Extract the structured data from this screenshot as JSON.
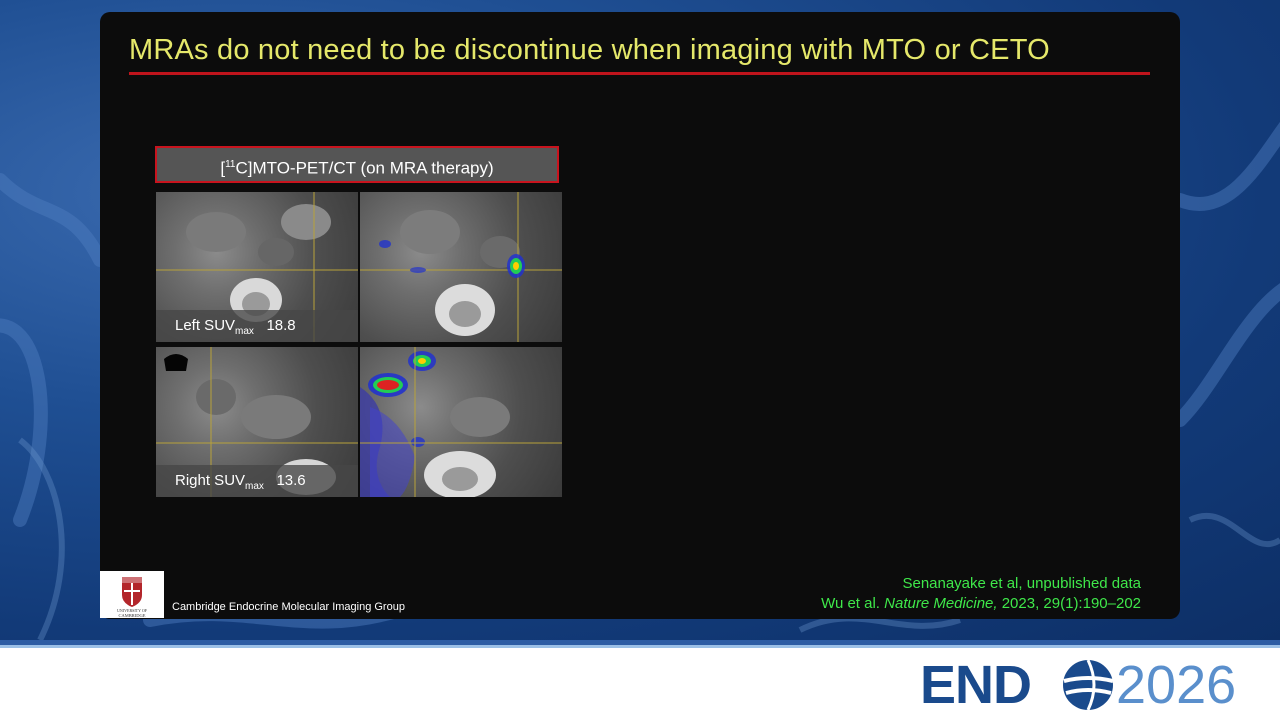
{
  "slide": {
    "title": "MRAs do not need to be discontinue when imaging with MTO or CETO",
    "panel_header_prefix": "[",
    "panel_header_sup": "11",
    "panel_header_rest": "C]MTO-PET/CT (on MRA therapy)",
    "left_label_main": "Left SUV",
    "left_label_sub": "max",
    "left_value": "18.8",
    "right_label_main": "Right SUV",
    "right_label_sub": "max",
    "right_value": "13.6"
  },
  "references": {
    "line1": "Senanayake et al, unpublished data",
    "line2_prefix": "Wu et al. ",
    "line2_journal": "Nature Medicine,",
    "line2_suffix": " 2023, 29(1):190–202"
  },
  "footer": {
    "group_name": "Cambridge Endocrine Molecular Imaging Group",
    "university_logo_text": "UNIVERSITY OF CAMBRIDGE",
    "conference_logo_a": "END",
    "conference_logo_b": "2026"
  },
  "colors": {
    "title": "#e5e86a",
    "rule": "#c0141c",
    "reference_text": "#3fe84a",
    "brand_blue": "#1a4a8c"
  }
}
